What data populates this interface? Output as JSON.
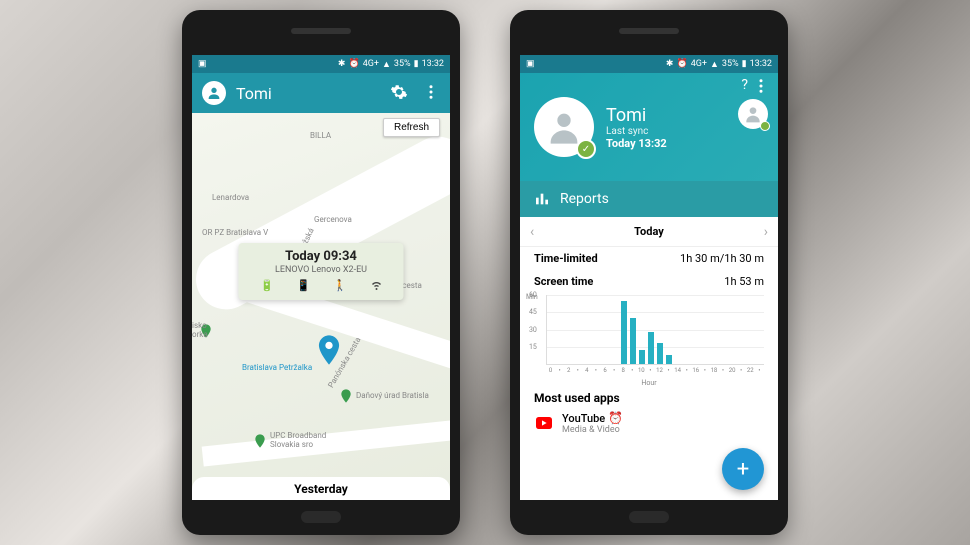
{
  "statusbar": {
    "battery": "35%",
    "time": "13:32"
  },
  "phone1": {
    "title": "Tomi",
    "refresh": "Refresh",
    "balloon": {
      "time": "Today 09:34",
      "device": "LENOVO Lenovo X2-EU"
    },
    "labels": {
      "billa": "BILLA",
      "police": "OR PZ Bratislava V",
      "isko": "isko\norka",
      "station": "Bratislava Petržalka",
      "tax": "Daňový úrad Bratisla",
      "upc": "UPC Broadband\nSlovakia sro",
      "rusov": "Rusovská cesta",
      "lenar": "Lenardova",
      "zapor": "Žaporožská",
      "gerc": "Gercenova",
      "panon": "Panónska cesta"
    },
    "bottom": "Yesterday"
  },
  "phone2": {
    "profile": {
      "name": "Tomi",
      "sync_label": "Last sync",
      "sync_time": "Today 13:32"
    },
    "reports_title": "Reports",
    "date_label": "Today",
    "stats": {
      "timelimit_k": "Time-limited",
      "timelimit_v": "1h 30 m/1h 30 m",
      "screentime_k": "Screen time",
      "screentime_v": "1h 53 m"
    },
    "most_used_title": "Most used apps",
    "app": {
      "name": "YouTube",
      "cat": "Media & Video"
    }
  },
  "chart_data": {
    "type": "bar",
    "xlabel": "Hour",
    "ylabel": "Min",
    "ylim": [
      0,
      60
    ],
    "yticks": [
      15,
      30,
      45,
      60
    ],
    "x": [
      0,
      1,
      2,
      3,
      4,
      5,
      6,
      7,
      8,
      9,
      10,
      11,
      12,
      13,
      14,
      15,
      16,
      17,
      18,
      19,
      20,
      21,
      22,
      23
    ],
    "values": [
      0,
      0,
      0,
      0,
      0,
      0,
      0,
      0,
      55,
      40,
      12,
      28,
      18,
      8,
      0,
      0,
      0,
      0,
      0,
      0,
      0,
      0,
      0,
      0
    ]
  }
}
